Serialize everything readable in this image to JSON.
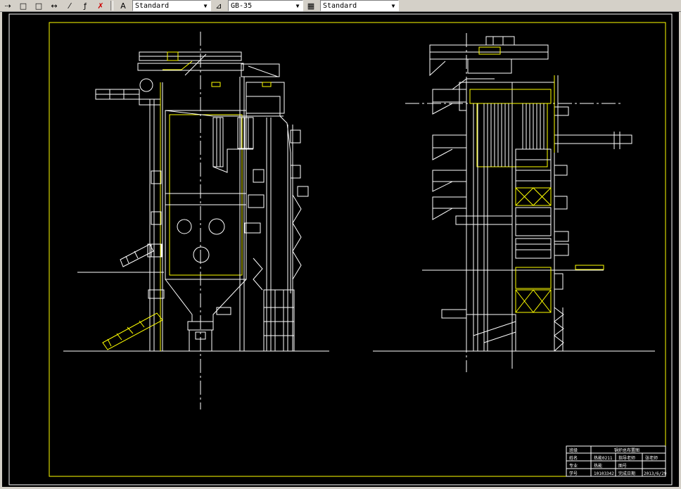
{
  "toolbar": {
    "icons": [
      "align-icon",
      "rect-icon",
      "rect-icon",
      "dimension-icon",
      "arc-icon",
      "leader-icon",
      "eraser-icon"
    ],
    "text_style": "Standard",
    "dim_style": "GB-35",
    "table_style": "Standard"
  },
  "title_block": {
    "row1": [
      "班级",
      "锅炉总布置图"
    ],
    "row2": [
      "姓名",
      "热能0211",
      "指导老师",
      "张老师"
    ],
    "row3": [
      "专业",
      "热能",
      "图号",
      ""
    ],
    "row4": [
      "学号",
      "10103342",
      "完成日期",
      "2013/6/29"
    ]
  },
  "colors": {
    "background": "#000000",
    "lines": "#ffffff",
    "accent": "#ffff00",
    "border": "#ffff00"
  }
}
